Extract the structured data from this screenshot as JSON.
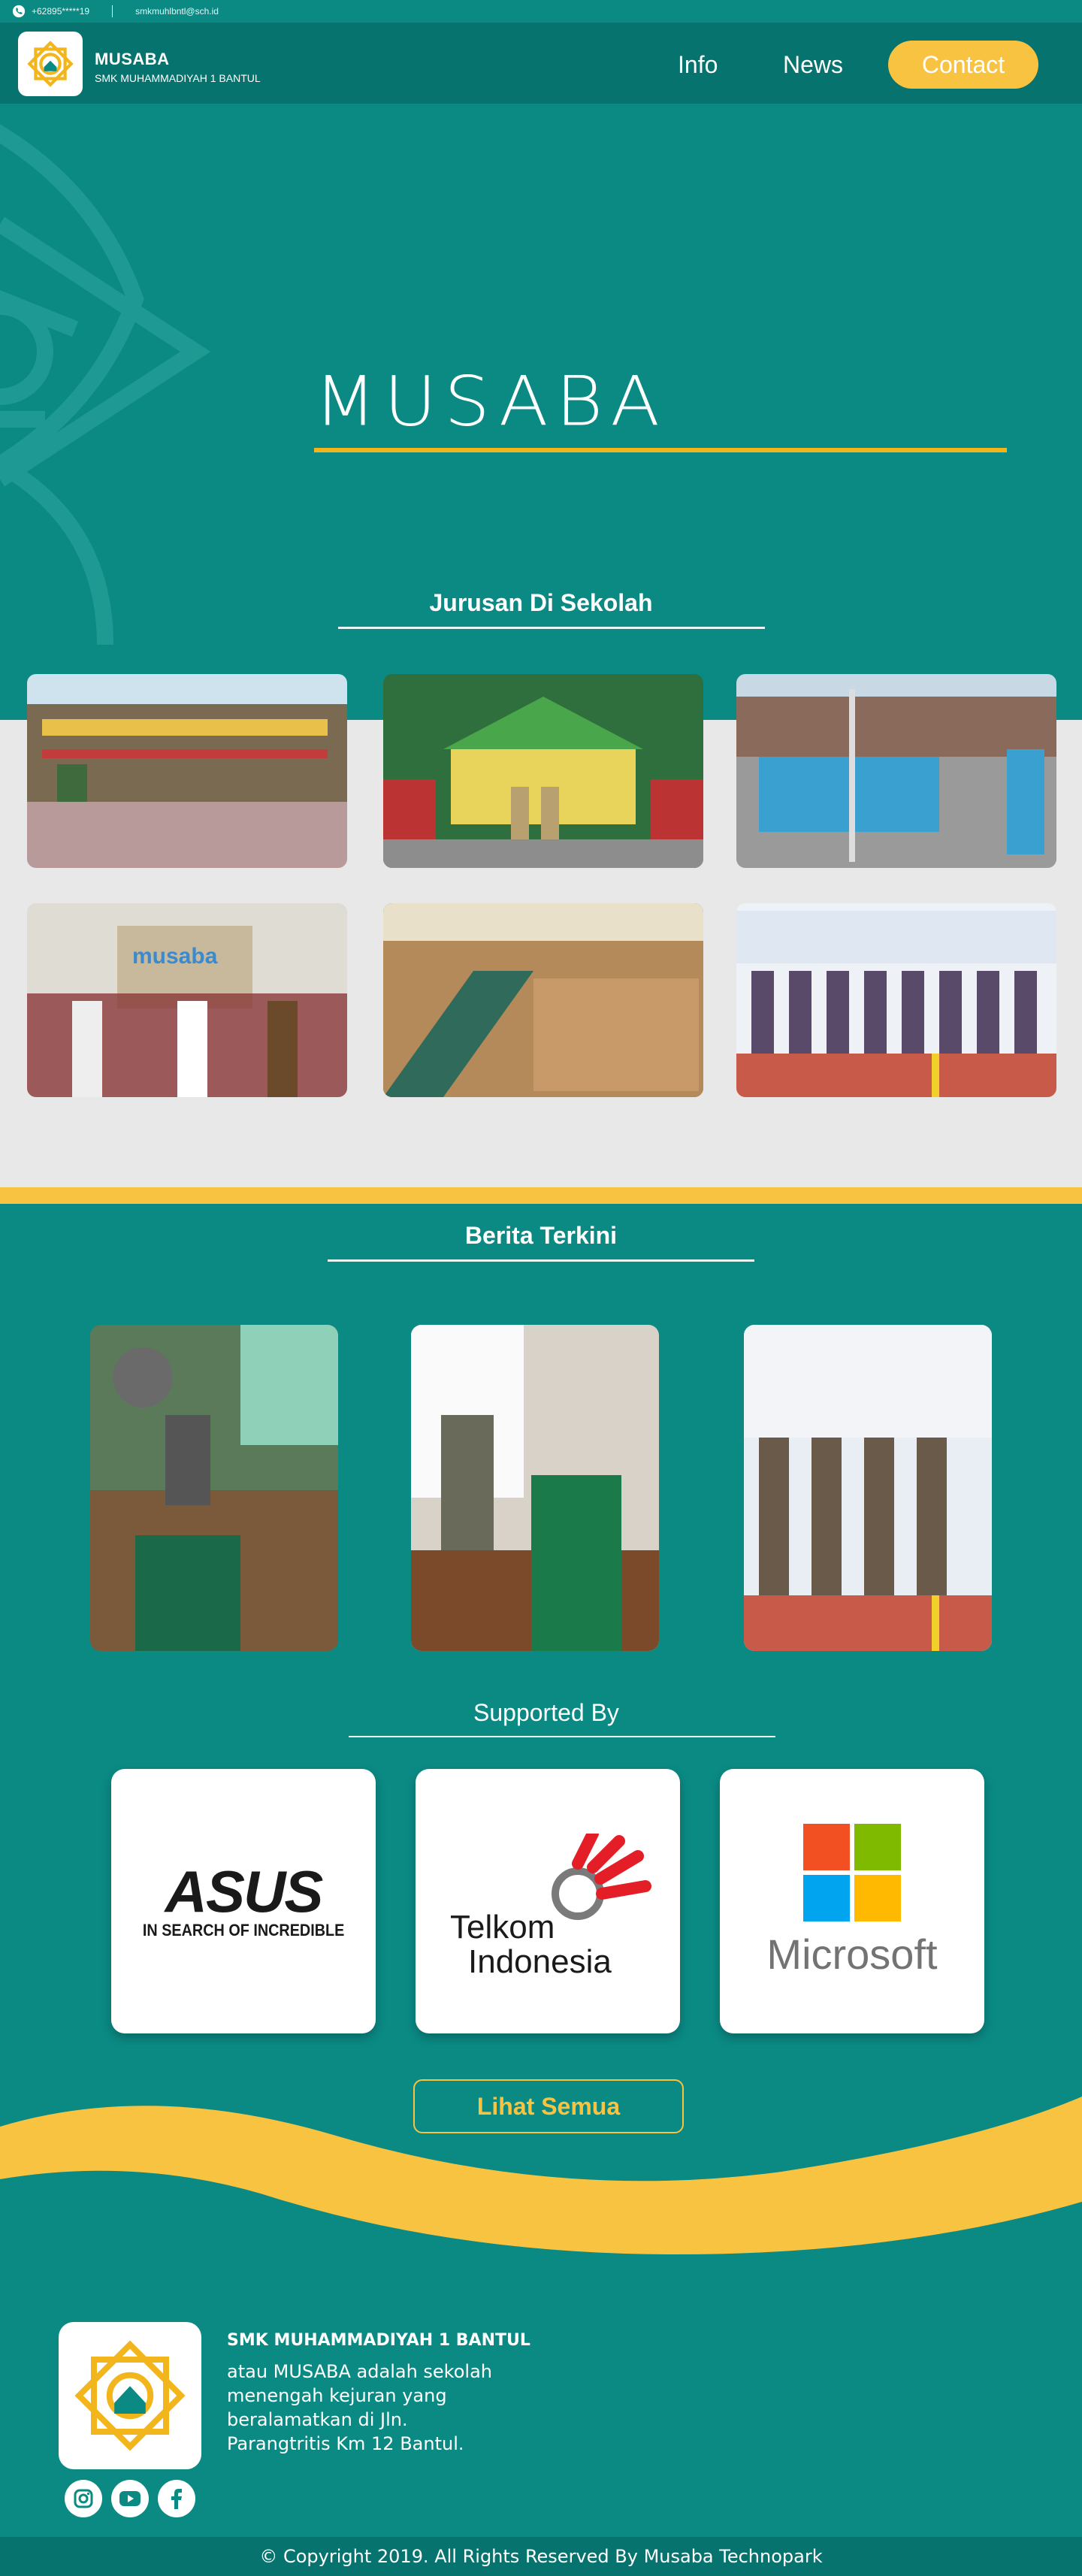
{
  "topbar": {
    "phone": "+62895*****19",
    "email": "smkmuhlbntl@sch.id"
  },
  "brand": {
    "name": "MUSABA",
    "subtitle": "SMK MUHAMMADIYAH 1 BANTUL"
  },
  "nav": {
    "info": "Info",
    "news": "News",
    "contact": "Contact"
  },
  "hero": {
    "title": "MUSABA"
  },
  "jurusan": {
    "title": "Jurusan Di Sekolah",
    "photos": [
      "school-building-photo",
      "school-gate-photo",
      "ceremony-photo",
      "musaba-office-photo",
      "prayer-photo",
      "group-photo"
    ]
  },
  "news": {
    "title": "Berita Terkini",
    "photos": [
      "classroom-presentation-photo",
      "classroom-teacher-photo",
      "officials-photo"
    ]
  },
  "supported": {
    "title": "Supported By",
    "sponsors": [
      {
        "name": "ASUS",
        "tagline": "IN SEARCH OF INCREDIBLE"
      },
      {
        "name": "Telkom Indonesia",
        "line1": "Telkom",
        "line2": "Indonesia"
      },
      {
        "name": "Microsoft"
      }
    ],
    "button": "Lihat Semua"
  },
  "footer": {
    "name": "SMK MUHAMMADIYAH 1 BANTUL",
    "description": "atau MUSABA adalah sekolah menengah kejuran yang beralamatkan di Jln. Parangtritis Km 12 Bantul.",
    "copyright": "© Copyright 2019. All Rights Reserved By Musaba Technopark"
  },
  "colors": {
    "teal": "#0b8a84",
    "dark_teal": "#07736e",
    "yellow": "#f9c342",
    "band": "#e9e8e8"
  }
}
